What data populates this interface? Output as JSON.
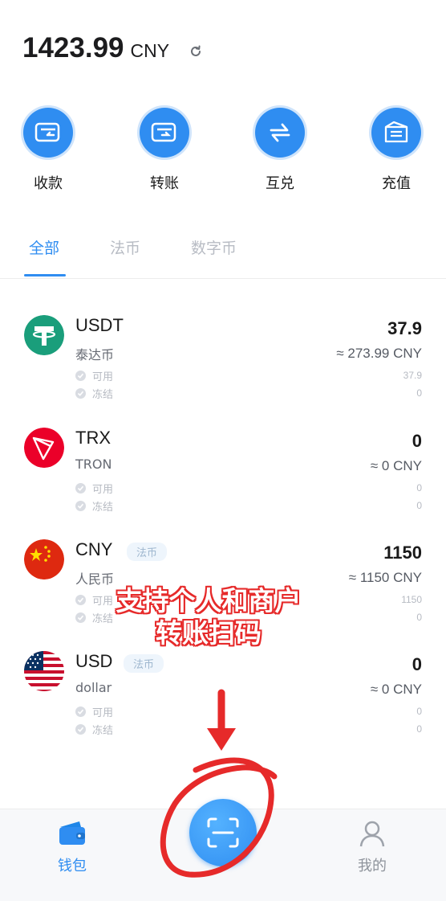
{
  "balance": {
    "amount": "1423.99",
    "unit": "CNY",
    "refresh_icon": "refresh-icon"
  },
  "actions": [
    {
      "label": "收款",
      "icon": "receive-wallet-icon"
    },
    {
      "label": "转账",
      "icon": "transfer-wallet-icon"
    },
    {
      "label": "互兑",
      "icon": "exchange-arrows-icon"
    },
    {
      "label": "充值",
      "icon": "recharge-icon"
    }
  ],
  "tabs": [
    {
      "label": "全部",
      "active": true
    },
    {
      "label": "法币",
      "active": false
    },
    {
      "label": "数字币",
      "active": false
    }
  ],
  "assets": [
    {
      "symbol": "USDT",
      "name": "泰达币",
      "tag": "",
      "value": "37.9",
      "converted": "≈ 273.99 CNY",
      "available_label": "可用",
      "available": "37.9",
      "frozen_label": "冻结",
      "frozen": "0",
      "logo": "tether-logo-icon"
    },
    {
      "symbol": "TRX",
      "name": "TRON",
      "tag": "",
      "value": "0",
      "converted": "≈ 0 CNY",
      "available_label": "可用",
      "available": "0",
      "frozen_label": "冻结",
      "frozen": "0",
      "logo": "tron-logo-icon"
    },
    {
      "symbol": "CNY",
      "name": "人民币",
      "tag": "法币",
      "value": "1150",
      "converted": "≈ 1150 CNY",
      "available_label": "可用",
      "available": "1150",
      "frozen_label": "冻结",
      "frozen": "0",
      "logo": "china-flag-icon"
    },
    {
      "symbol": "USD",
      "name": "dollar",
      "tag": "法币",
      "value": "0",
      "converted": "≈ 0 CNY",
      "available_label": "可用",
      "available": "0",
      "frozen_label": "冻结",
      "frozen": "0",
      "logo": "usa-flag-icon"
    }
  ],
  "promo": {
    "line1": "支持个人和商户",
    "line2": "转账扫码"
  },
  "bottom_nav": [
    {
      "label": "钱包",
      "icon": "wallet-icon",
      "active": true
    },
    {
      "label": "我的",
      "icon": "profile-icon",
      "active": false
    }
  ],
  "scan_button": {
    "icon": "scan-icon"
  },
  "colors": {
    "accent": "#2f8df1",
    "annotation": "#e62a2a",
    "tether": "#1a9e7b",
    "tron": "#eb0029"
  }
}
